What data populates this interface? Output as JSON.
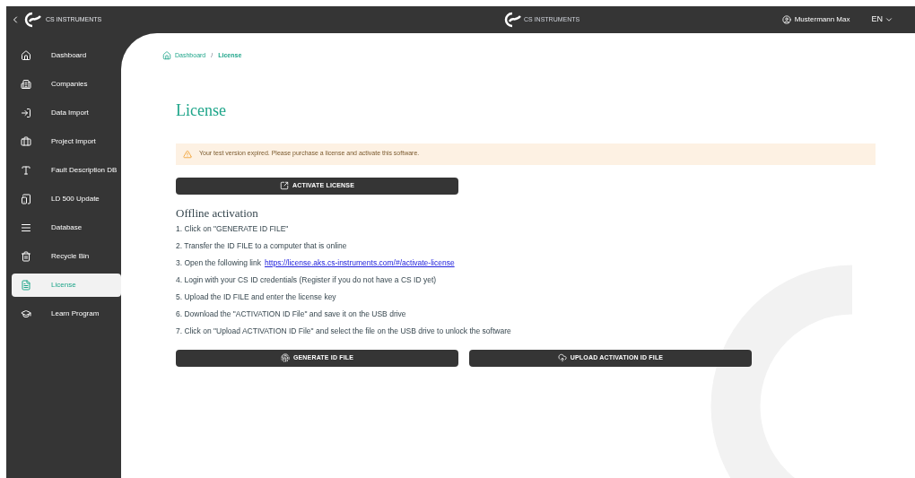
{
  "sidebar": {
    "logo_text": "CS INSTRUMENTS",
    "items": [
      {
        "label": "Dashboard",
        "selected": false
      },
      {
        "label": "Companies",
        "selected": false
      },
      {
        "label": "Data Import",
        "selected": false
      },
      {
        "label": "Project Import",
        "selected": false
      },
      {
        "label": "Fault Description DB",
        "selected": false
      },
      {
        "label": "LD 500 Update",
        "selected": false
      },
      {
        "label": "Database",
        "selected": false
      },
      {
        "label": "Recycle Bin",
        "selected": false
      },
      {
        "label": "License",
        "selected": true
      },
      {
        "label": "Learn Program",
        "selected": false
      }
    ]
  },
  "topbar": {
    "logo_text": "CS INSTRUMENTS",
    "user": "Mustermann Max",
    "language": "EN"
  },
  "breadcrumb": {
    "separator": "/",
    "items": [
      {
        "label": "Dashboard",
        "current": false
      },
      {
        "label": "License",
        "current": true
      }
    ]
  },
  "title": "License",
  "alert": "Your test version expired. Please purchase a license and activate this software.",
  "activate_button": "ACTIVATE LICENSE",
  "offline": {
    "heading": "Offline activation",
    "steps": [
      {
        "text": "1. Click on \"GENERATE ID FILE\""
      },
      {
        "text": "2. Transfer the ID FILE to a computer that is online"
      },
      {
        "text": "3. Open the following link",
        "link": "https://license.aks.cs-instruments.com/#/activate-license"
      },
      {
        "text": "4. Login with your CS ID credentials (Register if you do not have a CS ID yet)"
      },
      {
        "text": "5. Upload the ID FILE and enter the license key"
      },
      {
        "text": "6. Download the \"ACTIVATION ID File\" and save it on the USB drive"
      },
      {
        "text": "7. Click on \"Upload ACTIVATION ID File\" and select the file on the USB drive to unlock the software"
      }
    ]
  },
  "buttons": [
    "GENERATE ID FILE",
    "UPLOAD ACTIVATION ID FILE"
  ]
}
